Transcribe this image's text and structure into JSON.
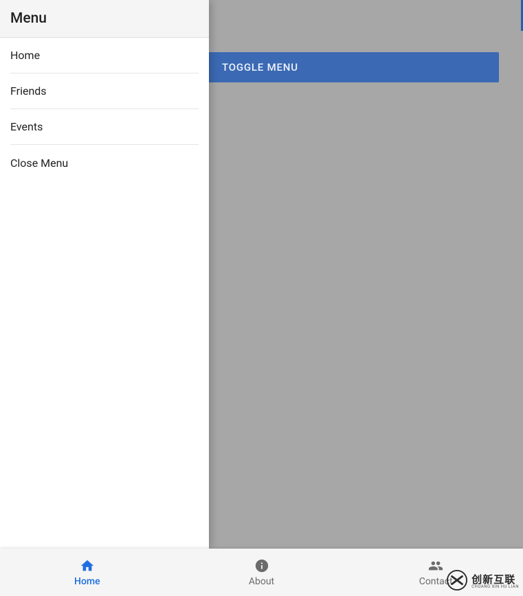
{
  "drawer": {
    "title": "Menu",
    "items": [
      {
        "label": "Home"
      },
      {
        "label": "Friends"
      },
      {
        "label": "Events"
      },
      {
        "label": "Close Menu"
      }
    ]
  },
  "main": {
    "toggle_button_label": "TOGGLE MENU"
  },
  "bottom_nav": {
    "tabs": [
      {
        "label": "Home",
        "icon": "home-icon",
        "active": true
      },
      {
        "label": "About",
        "icon": "info-icon",
        "active": false
      },
      {
        "label": "Contact",
        "icon": "people-icon",
        "active": false
      }
    ]
  },
  "watermark": {
    "main": "创新互联",
    "sub": "CHUANG XIN HU LIAN"
  },
  "colors": {
    "primary": "#3b69b3",
    "active": "#1e6fe0",
    "bg_grey": "#a7a7a7",
    "panel": "#f5f5f5"
  }
}
